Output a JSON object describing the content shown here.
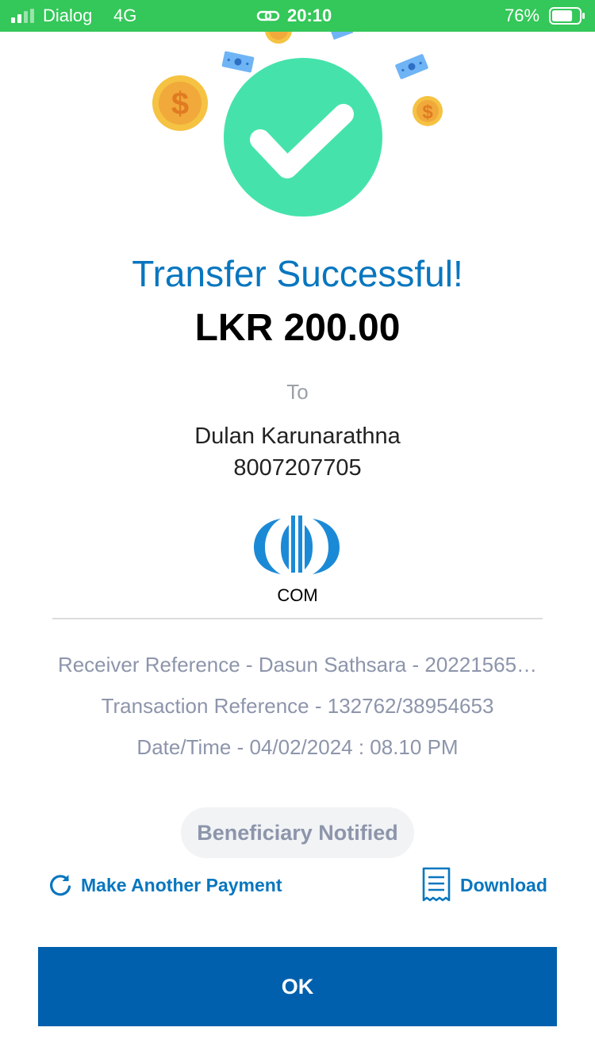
{
  "status_bar": {
    "carrier": "Dialog",
    "network": "4G",
    "time": "20:10",
    "battery_percent": "76%",
    "battery_level": 0.76,
    "color": "#34c759"
  },
  "title": "Transfer Successful!",
  "amount": "LKR 200.00",
  "to_label": "To",
  "recipient": {
    "name": "Dulan Karunarathna",
    "account": "8007207705"
  },
  "bank": {
    "code": "COM",
    "logo_icon": "commercial-bank-logo"
  },
  "details": {
    "receiver_reference": "Receiver Reference - Dasun Sathsara - 20221565…",
    "transaction_reference": "Transaction Reference - 132762/38954653",
    "date_time": "Date/Time -  04/02/2024 : 08.10 PM"
  },
  "badge": "Beneficiary Notified",
  "actions": {
    "make_another_payment": "Make Another Payment",
    "make_another_payment_icon": "refresh-icon",
    "download": "Download",
    "download_icon": "receipt-icon"
  },
  "ok_button": "OK",
  "colors": {
    "accent_blue": "#0876bf",
    "button_blue": "#0060ad",
    "success_green": "#45e3ab",
    "coin_gold": "#f5c242",
    "muted_text": "#8d95ab"
  }
}
